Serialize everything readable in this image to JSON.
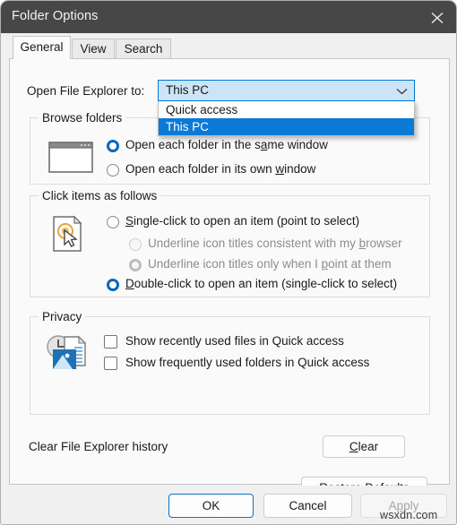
{
  "window": {
    "title": "Folder Options",
    "close_icon": "close-icon",
    "titlebar_color": "#474747"
  },
  "tabs": [
    {
      "label": "General",
      "active": true
    },
    {
      "label": "View",
      "active": false
    },
    {
      "label": "Search",
      "active": false
    }
  ],
  "combobox": {
    "label": "Open File Explorer to:",
    "value": "This PC",
    "expanded": true,
    "arrow_icon": "chevron-down-icon",
    "accent": "#0078d4",
    "field_fill": "#cce4f7",
    "options": [
      {
        "label": "Quick access",
        "selected": false
      },
      {
        "label": "This PC",
        "selected": true
      }
    ]
  },
  "browse_folders": {
    "title": "Browse folders",
    "icon": "window-outline-icon",
    "options": [
      {
        "text_pre": "Open each folder in the s",
        "accel": "a",
        "text_post": "me window",
        "selected": true,
        "disabled": false
      },
      {
        "text_pre": "Open each folder in its own ",
        "accel": "w",
        "text_post": "indow",
        "selected": false,
        "disabled": false
      }
    ]
  },
  "click_items": {
    "title": "Click items as follows",
    "icon": "document-click-cursor-icon",
    "options": [
      {
        "text_pre": "",
        "accel": "S",
        "text_post": "ingle-click to open an item (point to select)",
        "selected": false,
        "disabled": false,
        "indent": false
      },
      {
        "text_pre": "Underline icon titles consistent with my ",
        "accel": "b",
        "text_post": "rowser",
        "selected": false,
        "disabled": true,
        "indent": true
      },
      {
        "text_pre": "Underline icon titles only when I ",
        "accel": "p",
        "text_post": "oint at them",
        "selected": true,
        "disabled": true,
        "indent": true
      },
      {
        "text_pre": "",
        "accel": "D",
        "text_post": "ouble-click to open an item (single-click to select)",
        "selected": true,
        "disabled": false,
        "indent": false
      }
    ]
  },
  "privacy": {
    "title": "Privacy",
    "icon": "recent-files-picture-icon",
    "checkboxes": [
      {
        "label": "Show recently used files in Quick access",
        "checked": false
      },
      {
        "label": "Show frequently used folders in Quick access",
        "checked": false
      }
    ],
    "clear_history_label": "Clear File Explorer history",
    "clear_button": {
      "text_pre": "",
      "accel": "C",
      "text_post": "lear"
    }
  },
  "restore_button": {
    "text_pre": "",
    "accel": "R",
    "text_post": "estore Defaults"
  },
  "footer": {
    "ok": "OK",
    "cancel": "Cancel",
    "apply": {
      "text_pre": "A",
      "accel": "p",
      "text_post": "ply",
      "disabled": true
    }
  },
  "watermark": "wsxdn.com"
}
